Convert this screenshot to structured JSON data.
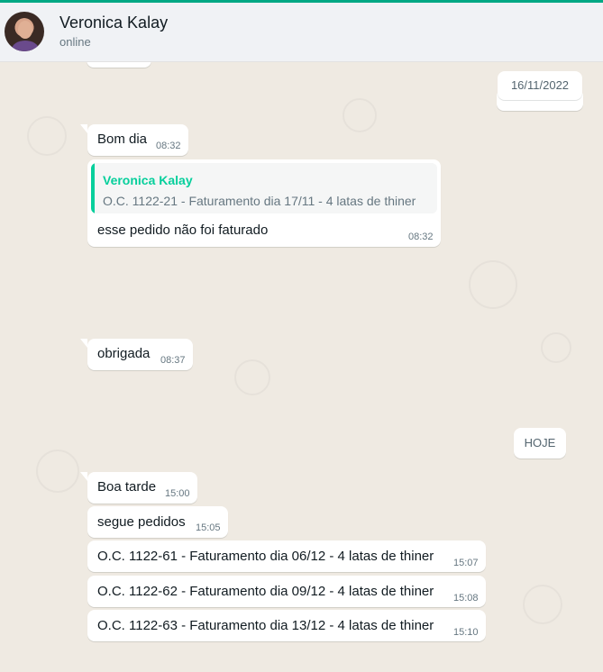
{
  "contact": {
    "name": "Veronica Kalay",
    "status": "online"
  },
  "dates": {
    "previous": "16/11/2022",
    "today": "HOJE"
  },
  "messages": [
    {
      "text": "Bom dia",
      "time": "08:32"
    },
    {
      "quote_author": "Veronica Kalay",
      "quote_text": "O.C. 1122-21 - Faturamento dia 17/11 - 4 latas de thiner",
      "text": "esse pedido não foi faturado",
      "time": "08:32"
    },
    {
      "text": "obrigada",
      "time": "08:37"
    },
    {
      "text": "Boa tarde",
      "time": "15:00"
    },
    {
      "text": "segue pedidos",
      "time": "15:05"
    },
    {
      "text": "O.C. 1122-61 - Faturamento dia 06/12 - 4 latas de thiner",
      "time": "15:07"
    },
    {
      "text": "O.C. 1122-62 - Faturamento dia 09/12 - 4 latas de thiner",
      "time": "15:08"
    },
    {
      "text": "O.C. 1122-63 - Faturamento dia 13/12 - 4 latas de thiner",
      "time": "15:10"
    }
  ]
}
